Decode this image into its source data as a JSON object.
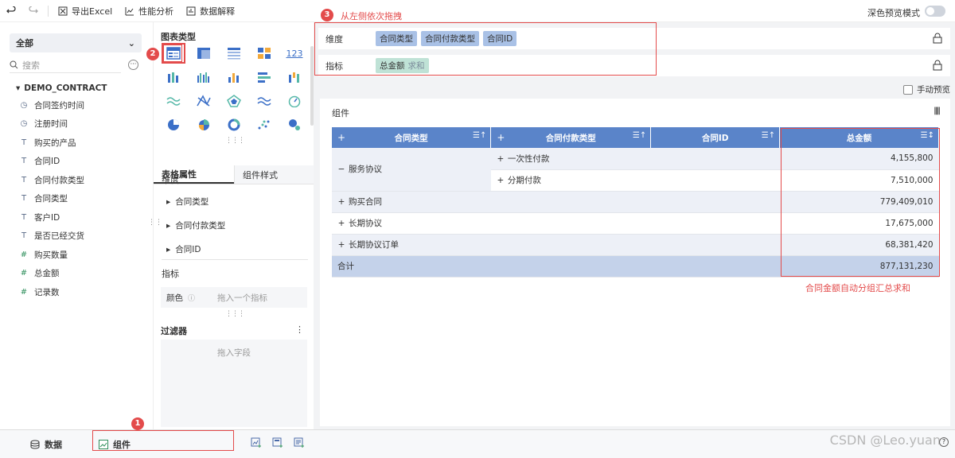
{
  "toolbar": {
    "undo_icon": "undo-icon",
    "redo_icon": "redo-icon",
    "export_label": "导出Excel",
    "perf_label": "性能分析",
    "explain_label": "数据解释",
    "dark_preview_label": "深色预览模式"
  },
  "left": {
    "selector_value": "全部",
    "search_placeholder": "搜索",
    "dataset_name": "DEMO_CONTRACT",
    "fields": [
      {
        "type": "date",
        "label": "合同签约时间"
      },
      {
        "type": "date",
        "label": "注册时间"
      },
      {
        "type": "text",
        "label": "购买的产品"
      },
      {
        "type": "text",
        "label": "合同ID"
      },
      {
        "type": "text",
        "label": "合同付款类型"
      },
      {
        "type": "text",
        "label": "合同类型"
      },
      {
        "type": "text",
        "label": "客户ID"
      },
      {
        "type": "text",
        "label": "是否已经交货"
      },
      {
        "type": "number",
        "label": "购买数量"
      },
      {
        "type": "number",
        "label": "总金额"
      },
      {
        "type": "number",
        "label": "记录数"
      }
    ]
  },
  "mid": {
    "chart_type_title": "图表类型",
    "tab_table_props": "表格属性",
    "tab_component_style": "组件样式",
    "dimension_label": "维度",
    "dimension_items": [
      "合同类型",
      "合同付款类型",
      "合同ID"
    ],
    "metric_label": "指标",
    "color_label": "颜色",
    "color_placeholder": "拖入一个指标",
    "filter_title": "过滤器",
    "filter_placeholder": "拖入字段"
  },
  "shelf": {
    "dimension_label": "维度",
    "dimension_pills": [
      "合同类型",
      "合同付款类型",
      "合同ID"
    ],
    "metric_label": "指标",
    "metric_pill": "总金额",
    "metric_agg": "求和",
    "manual_preview_label": "手动预览"
  },
  "component": {
    "title": "组件",
    "headers": [
      "合同类型",
      "合同付款类型",
      "合同ID",
      "总金额"
    ],
    "rows": [
      {
        "type": "服务协议",
        "pay": "一次性付款",
        "amount": "4,155,800"
      },
      {
        "pay": "分期付款",
        "amount": "7,510,000"
      },
      {
        "type": "购买合同",
        "amount": "779,409,010"
      },
      {
        "type": "长期协议",
        "amount": "17,675,000"
      },
      {
        "type": "长期协议订单",
        "amount": "68,381,420"
      }
    ],
    "total_label": "合计",
    "total_amount": "877,131,230"
  },
  "annotations": {
    "badge1": "1",
    "badge2": "2",
    "badge3": "3",
    "drag_note": "从左侧依次拖拽",
    "sum_note": "合同金额自动分组汇总求和"
  },
  "bottom": {
    "data_tab": "数据",
    "component_tab": "组件"
  },
  "watermark": "CSDN @Leo.yuan",
  "colors": {
    "header_blue": "#5a84c9",
    "pill_blue": "#a9c1e6",
    "pill_green": "#bfe2d6",
    "annotation_red": "#e34b4b"
  }
}
